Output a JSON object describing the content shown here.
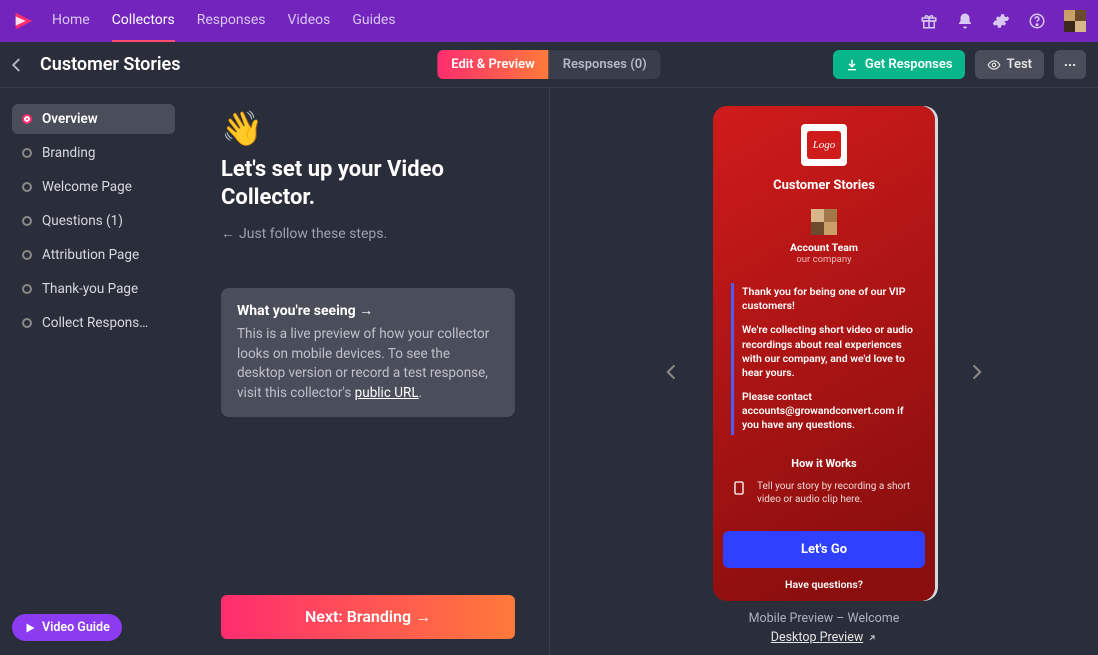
{
  "nav": {
    "items": [
      "Home",
      "Collectors",
      "Responses",
      "Videos",
      "Guides"
    ],
    "active": "Collectors"
  },
  "subbar": {
    "title": "Customer Stories",
    "pills": {
      "edit": "Edit & Preview",
      "responses": "Responses (0)"
    },
    "buttons": {
      "get_responses": "Get Responses",
      "test": "Test"
    }
  },
  "sidebar": {
    "items": [
      {
        "label": "Overview"
      },
      {
        "label": "Branding"
      },
      {
        "label": "Welcome Page"
      },
      {
        "label": "Questions (1)"
      },
      {
        "label": "Attribution Page"
      },
      {
        "label": "Thank-you Page"
      },
      {
        "label": "Collect Respons…"
      }
    ],
    "active_index": 0,
    "video_guide_label": "Video Guide"
  },
  "mid": {
    "wave": "👋",
    "headline": "Let's set up your Video Collector.",
    "substep": "Just follow these steps.",
    "card": {
      "title": "What you're seeing →",
      "body_prefix": "This is a live preview of how your collector looks on mobile devices. To see the desktop version or record a test response, visit this collector's ",
      "body_link": "public URL",
      "body_suffix": "."
    },
    "next_button": "Next: Branding →"
  },
  "preview": {
    "logo_text": "Logo",
    "title": "Customer Stories",
    "team_name": "Account Team",
    "team_sub": "our company",
    "msg1": "Thank you for being one of our VIP customers!",
    "msg2": "We're collecting short video or audio recordings about real experiences with our company, and we'd love to hear yours.",
    "msg3": "Please contact accounts@growandconvert.com if you have any questions.",
    "how_it_works": "How it Works",
    "how_row": "Tell your story by recording a short video or audio clip here.",
    "letsgo": "Let's Go",
    "haveq": "Have questions?",
    "caption": "Mobile Preview – Welcome",
    "desktop_link": "Desktop Preview"
  }
}
